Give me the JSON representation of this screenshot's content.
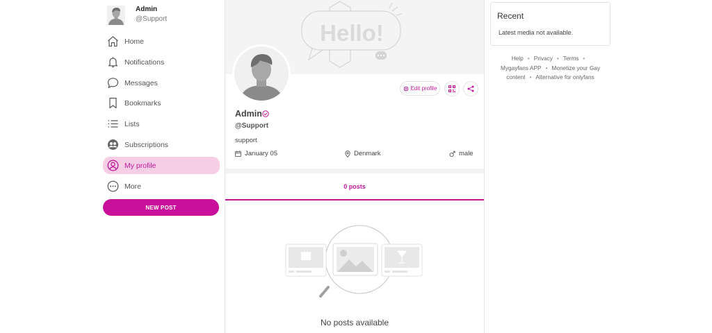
{
  "sidebar": {
    "user": {
      "name": "Admin",
      "handle": "@Support"
    },
    "nav": [
      {
        "label": "Home",
        "icon": "home-icon"
      },
      {
        "label": "Notifications",
        "icon": "bell-icon"
      },
      {
        "label": "Messages",
        "icon": "chat-bubble-icon"
      },
      {
        "label": "Bookmarks",
        "icon": "bookmark-icon"
      },
      {
        "label": "Lists",
        "icon": "list-icon"
      },
      {
        "label": "Subscriptions",
        "icon": "subscriptions-icon"
      },
      {
        "label": "My profile",
        "icon": "user-circle-icon",
        "active": true
      },
      {
        "label": "More",
        "icon": "more-icon"
      }
    ],
    "new_post_label": "NEW POST"
  },
  "profile": {
    "cover_text": "Hello!",
    "name": "Admin",
    "handle": "@Support",
    "bio": "support",
    "birthday": "January 05",
    "location": "Denmark",
    "gender": "male",
    "edit_label": "Edit profile"
  },
  "tabs": {
    "posts_label": "0 posts"
  },
  "empty": {
    "message": "No posts available"
  },
  "right": {
    "recent_title": "Recent",
    "recent_message": "Latest media not available.",
    "links": {
      "help": "Help",
      "privacy": "Privacy",
      "terms": "Terms",
      "app": "Mygayfans APP",
      "monetize": "Monetize your Gay content",
      "alternative": "Alternative for onlyfans"
    }
  },
  "colors": {
    "accent": "#c8109a",
    "active_bg": "#f6cfe6"
  }
}
